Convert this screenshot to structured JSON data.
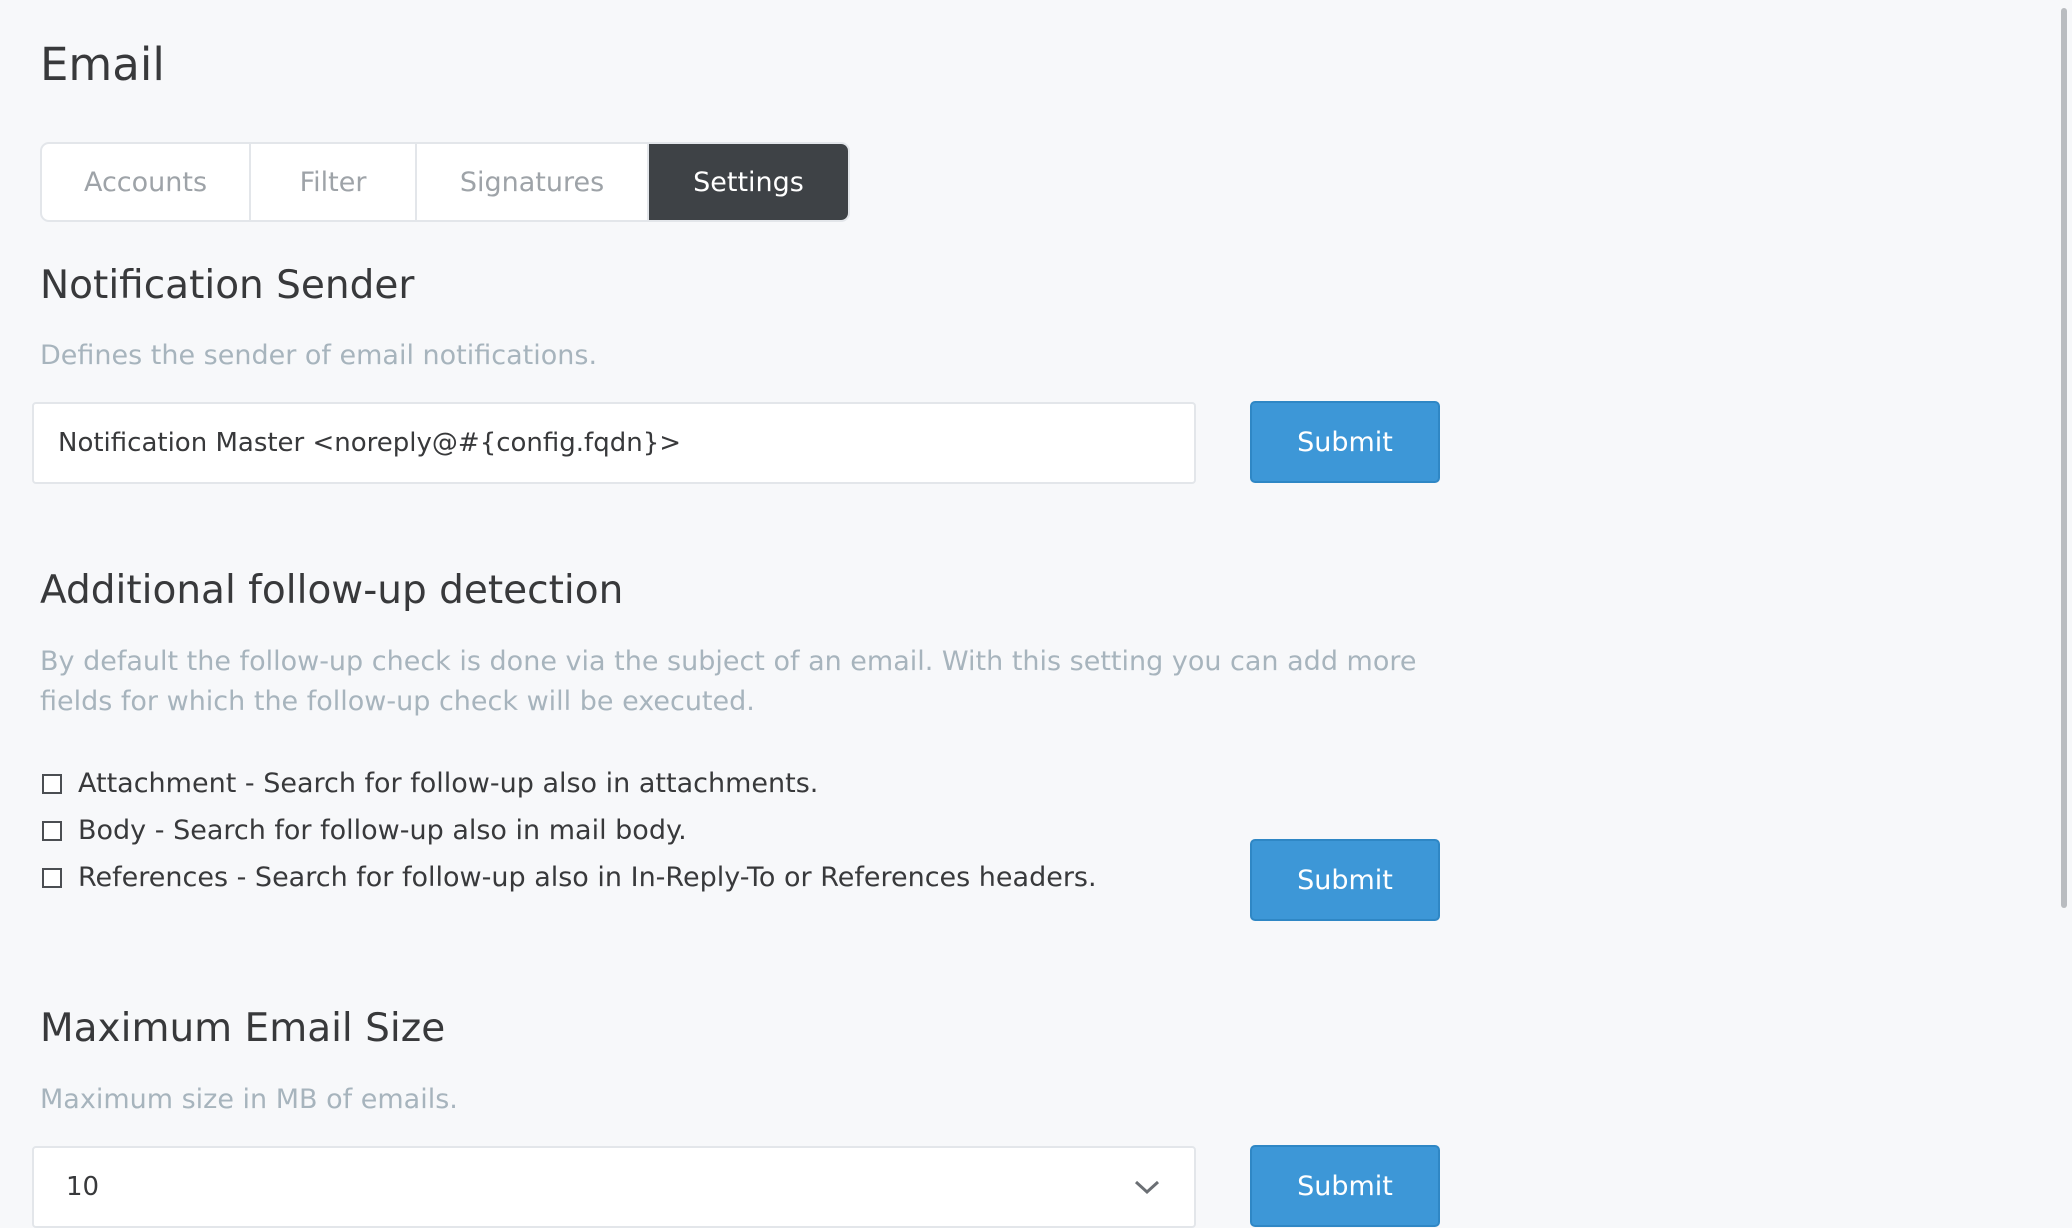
{
  "page": {
    "title": "Email"
  },
  "tabs": [
    {
      "label": "Accounts",
      "active": false
    },
    {
      "label": "Filter",
      "active": false
    },
    {
      "label": "Signatures",
      "active": false
    },
    {
      "label": "Settings",
      "active": true
    }
  ],
  "notification_sender": {
    "title": "Notification Sender",
    "description": "Defines the sender of email notifications.",
    "value": "Notification Master <noreply@#{config.fqdn}>",
    "submit_label": "Submit"
  },
  "followup": {
    "title": "Additional follow-up detection",
    "description": "By default the follow-up check is done via the subject of an email. With this setting you can add more fields for which the follow-up check will be executed.",
    "options": [
      {
        "label": "Attachment - Search for follow-up also in attachments.",
        "checked": false
      },
      {
        "label": "Body - Search for follow-up also in mail body.",
        "checked": false
      },
      {
        "label": "References - Search for follow-up also in In-Reply-To or References headers.",
        "checked": false
      }
    ],
    "submit_label": "Submit"
  },
  "max_size": {
    "title": "Maximum Email Size",
    "description": "Maximum size in MB of emails.",
    "selected_value": "10",
    "submit_label": "Submit"
  },
  "colors": {
    "accent": "#3d97d7",
    "active_tab": "#3e4246",
    "muted_text": "#a7b4bd"
  },
  "icons": {
    "select_chevron": "chevron-down-icon"
  }
}
